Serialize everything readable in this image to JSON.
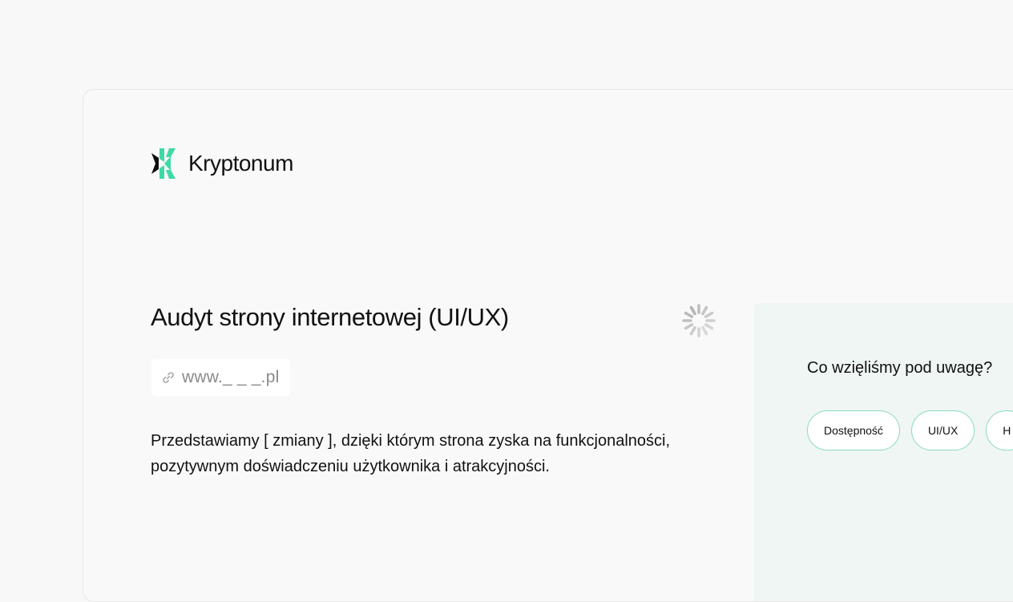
{
  "brand": {
    "name": "Kryptonum",
    "colors": {
      "accent": "#3fd9a6",
      "dark": "#0d0d0d"
    }
  },
  "hero": {
    "title": "Audyt strony internetowej (UI/UX)",
    "url_icon": "link-icon",
    "url_text": "www._ _ _.pl",
    "description_line1": "Przedstawiamy [ zmiany ], dzięki którym strona zyska na funkcjonalności,",
    "description_line2": "pozytywnym doświadczeniu użytkownika i atrakcyjności.",
    "spinner_icon": "loading-spinner-icon"
  },
  "aside": {
    "title": "Co wzięliśmy pod uwagę?",
    "chips": [
      "Dostępność",
      "UI/UX",
      "H"
    ]
  }
}
